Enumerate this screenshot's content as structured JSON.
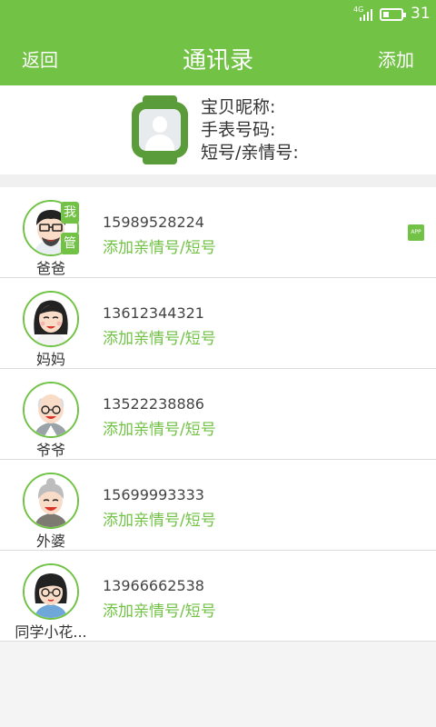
{
  "status_bar": {
    "network": "4G",
    "time": "31",
    "signal_icon": "signal-icon",
    "battery_icon": "battery-icon"
  },
  "app_bar": {
    "back_label": "返回",
    "title": "通讯录",
    "add_label": "添加"
  },
  "device": {
    "icon": "watch-icon",
    "nickname_label": "宝贝昵称:",
    "watch_number_label": "手表号码:",
    "short_number_label": "短号/亲情号:"
  },
  "colors": {
    "brand": "#71c245",
    "watch": "#5a9b3a"
  },
  "contacts": [
    {
      "name": "爸爸",
      "phone": "15989528224",
      "relation_action": "添加亲情号/短号",
      "badge_me": "我",
      "badge_admin": "管",
      "app_tag": "APP",
      "avatar": "father-avatar"
    },
    {
      "name": "妈妈",
      "phone": "13612344321",
      "relation_action": "添加亲情号/短号",
      "avatar": "mother-avatar"
    },
    {
      "name": "爷爷",
      "phone": "13522238886",
      "relation_action": "添加亲情号/短号",
      "avatar": "grandfather-avatar"
    },
    {
      "name": "外婆",
      "phone": "15699993333",
      "relation_action": "添加亲情号/短号",
      "avatar": "grandmother-avatar"
    },
    {
      "name": "同学小花...",
      "phone": "13966662538",
      "relation_action": "添加亲情号/短号",
      "avatar": "classmate-avatar"
    }
  ]
}
